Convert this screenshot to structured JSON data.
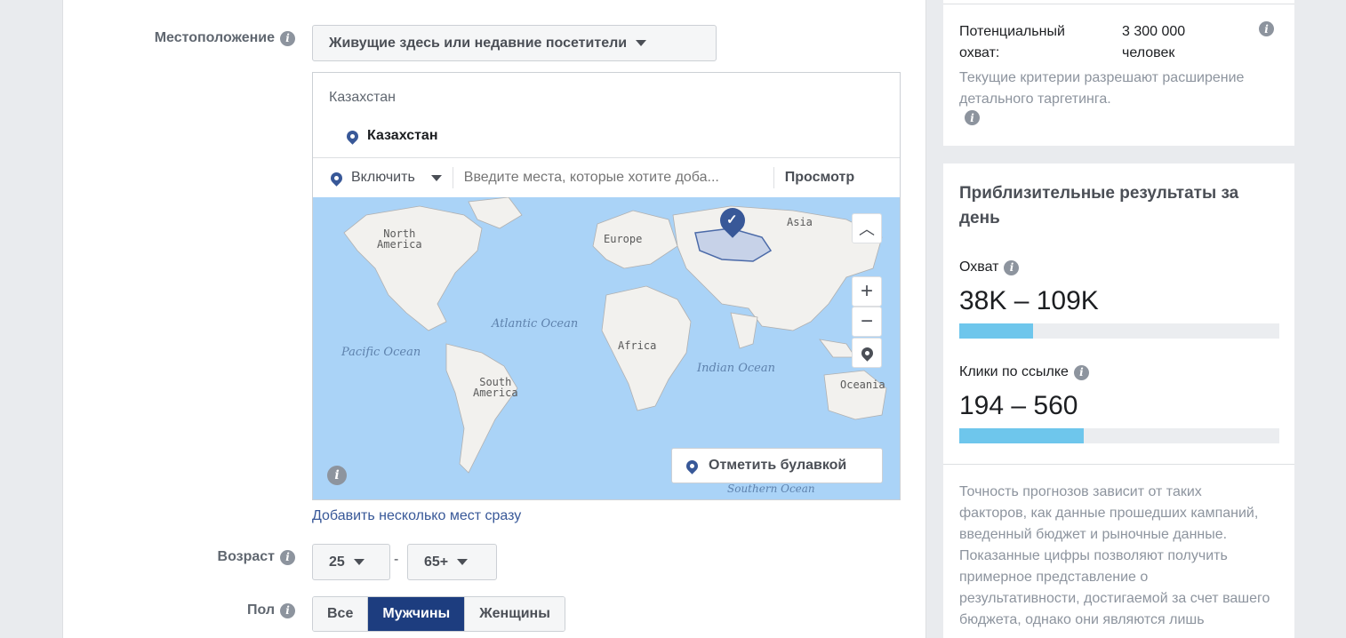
{
  "location": {
    "label": "Местоположение",
    "audience_dropdown": "Живущие здесь или недавние посетители",
    "country_group": "Казахстан",
    "selected_place": "Казахстан",
    "include_dropdown": "Включить",
    "search_placeholder": "Введите места, которые хотите доба...",
    "browse_link": "Просмотр",
    "add_bulk_link": "Добавить несколько мест сразу",
    "drop_pin_button": "Отметить булавкой"
  },
  "map": {
    "labels": {
      "north_america": "North\nAmerica",
      "south_america": "South\nAmerica",
      "europe": "Europe",
      "asia": "Asia",
      "africa": "Africa",
      "oceania": "Oceania",
      "atlantic": "Atlantic Ocean",
      "pacific": "Pacific Ocean",
      "indian": "Indian Ocean",
      "southern": "Southern Ocean"
    }
  },
  "age": {
    "label": "Возраст",
    "min": "25",
    "separator": "-",
    "max": "65+"
  },
  "gender": {
    "label": "Пол",
    "options": [
      "Все",
      "Мужчины",
      "Женщины"
    ],
    "selected": "Мужчины"
  },
  "potential_reach": {
    "label": "Потенциальный охват:",
    "value": "3 300 000 человек",
    "note": "Текущие критерии разрешают расширение детального таргетинга."
  },
  "daily_results": {
    "title": "Приблизительные результаты за день",
    "reach_label": "Охват",
    "reach_value": "38K – 109K",
    "reach_fill": 0.23,
    "clicks_label": "Клики по ссылке",
    "clicks_value": "194 – 560",
    "clicks_fill": 0.39,
    "disclaimer": "Точность прогнозов зависит от таких факторов, как данные прошедших кампаний, введенный бюджет и рыночные данные. Показанные цифры позволяют получить примерное представление о результативности, достигаемой за счет вашего бюджета, однако они являются лишь"
  },
  "colors": {
    "selected_segment": "#1d3d7f",
    "bar_fill": "#6ec6ec",
    "ocean": "#aad3f7",
    "pin": "#385898"
  }
}
